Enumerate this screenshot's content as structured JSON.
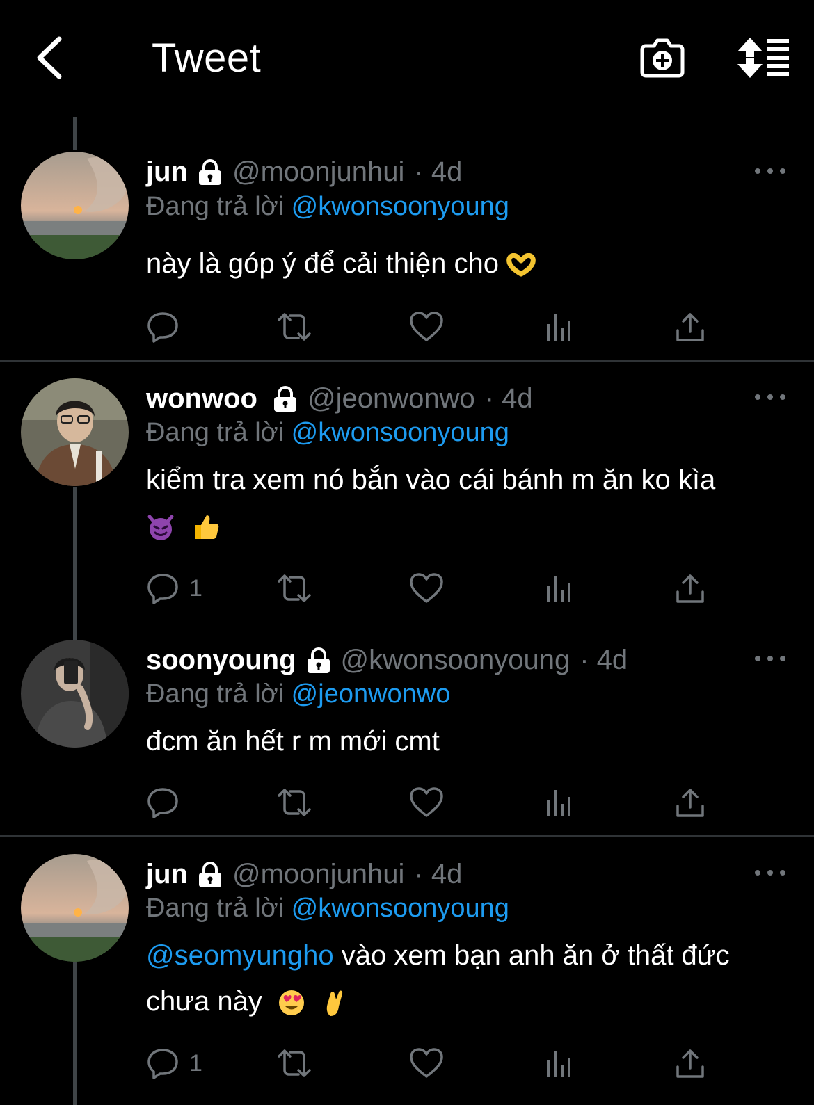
{
  "header": {
    "title": "Tweet",
    "back_icon": "chevron-left-icon",
    "camera_icon": "camera-plus-icon",
    "sort_icon": "sort-list-icon"
  },
  "colors": {
    "background": "#000000",
    "text": "#e7e9ea",
    "muted": "#71767b",
    "accent": "#1d9bf0",
    "thread_line": "#3f4447",
    "divider": "#2f3336"
  },
  "tweets": [
    {
      "name": "jun",
      "handle": "@moonjunhui",
      "time": "· 4d",
      "reply_prefix": "Đang trả lời",
      "reply_to": "@kwonsoonyoung",
      "text": "này là góp ý để cải thiện cho",
      "emoji": "heart-hands-emoji",
      "reply_count": ""
    },
    {
      "name": "wonwoo",
      "handle": "@jeonwonwo",
      "time": "· 4d",
      "reply_prefix": "Đang trả lời",
      "reply_to": "@kwonsoonyoung",
      "text": "kiểm tra xem nó bắn vào cái bánh m ăn ko kìa",
      "emoji": "smiling-devil-emoji, thumbs-up-emoji",
      "reply_count": "1"
    },
    {
      "name": "soonyoung",
      "handle": "@kwonsoonyoung",
      "time": "· 4d",
      "reply_prefix": "Đang trả lời",
      "reply_to": "@jeonwonwo",
      "text": "đcm ăn hết r m mới cmt",
      "reply_count": ""
    },
    {
      "name": "jun",
      "handle": "@moonjunhui",
      "time": "· 4d",
      "reply_prefix": "Đang trả lời",
      "reply_to": "@kwonsoonyoung",
      "mention": "@seomyungho",
      "text": " vào xem bạn anh ăn ở thất đức chưa này",
      "emoji": "heart-eyes-emoji, crossed-fingers-emoji",
      "reply_count": "1"
    }
  ]
}
